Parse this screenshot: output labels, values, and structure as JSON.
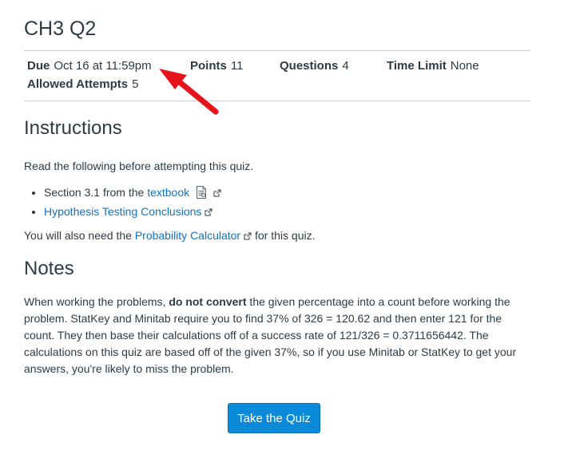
{
  "quiz": {
    "title": "CH3 Q2"
  },
  "details": {
    "due_label": "Due",
    "due_value": "Oct 16 at 11:59pm",
    "points_label": "Points",
    "points_value": "11",
    "questions_label": "Questions",
    "questions_value": "4",
    "time_limit_label": "Time Limit",
    "time_limit_value": "None",
    "attempts_label": "Allowed Attempts",
    "attempts_value": "5"
  },
  "instructions": {
    "heading": "Instructions",
    "intro": "Read the following before attempting this quiz.",
    "items": [
      {
        "prefix": "Section 3.1 from the ",
        "link": "textbook"
      },
      {
        "prefix": "",
        "link": "Hypothesis Testing Conclusions"
      }
    ],
    "calc_prefix": "You will also need the ",
    "calc_link": "Probability Calculator",
    "calc_suffix": "for this quiz."
  },
  "notes": {
    "heading": "Notes",
    "body_start": "When working the problems, ",
    "body_bold": "do not convert",
    "body_rest": " the given percentage into a count before working the problem. StatKey and Minitab require you to find 37% of 326 = 120.62 and then enter 121 for the count. They then base their calculations off of a success rate of 121/326 = 0.3711656442. The calculations on this quiz are based off of the given 37%, so if you use Minitab or StatKey to get your answers, you're likely to miss the problem."
  },
  "actions": {
    "take_quiz": "Take the Quiz"
  },
  "colors": {
    "link": "#0e72c4",
    "button": "#0b8ada",
    "arrow": "#e8141b"
  },
  "icons": [
    "document-icon",
    "external-link-icon",
    "red-arrow-annotation"
  ]
}
